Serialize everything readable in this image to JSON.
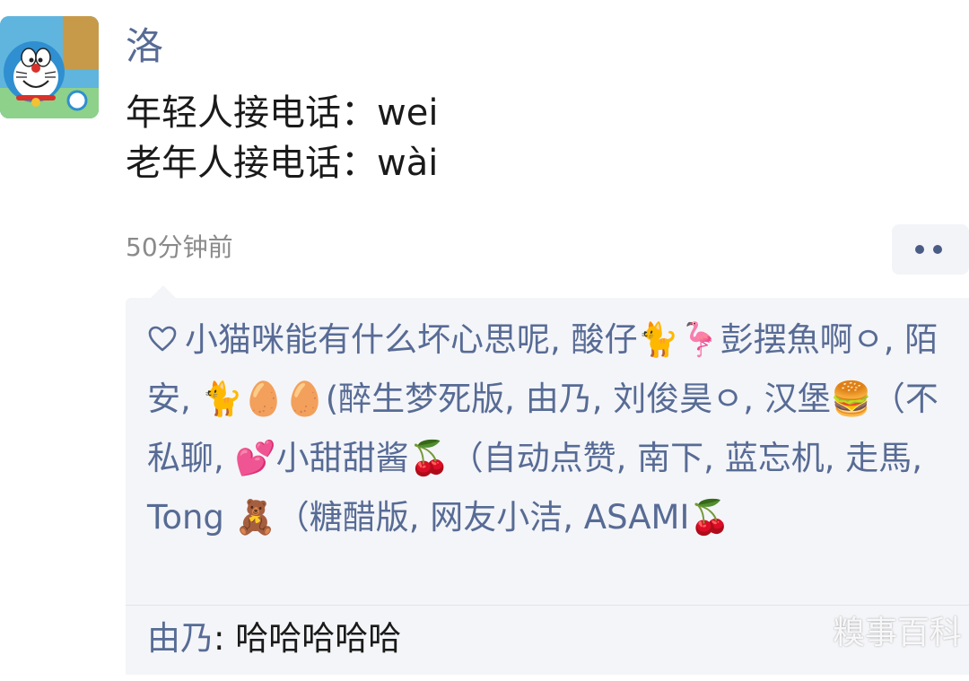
{
  "post": {
    "avatar_icon": "doraemon-avatar-icon",
    "username": "洛",
    "lines": [
      "年轻人接电话：wei",
      "老年人接电话：wài"
    ],
    "time": "50分钟前",
    "more_icon": "more-dots-icon"
  },
  "likes": {
    "icon": "heart-outline-icon",
    "text": "小猫咪能有什么坏心思呢, 酸仔🐈🦩彭摆魚啊ㅇ, 陌安, 🐈🥚🥚(醉生梦死版, 由乃, 刘俊昊ㅇ, 汉堡🍔（不私聊, 💕小甜甜酱🍒（自动点赞, 南下, 蓝忘机, 走馬, Tong 🧸（糖醋版, 网友小洁, ASAMI🍒"
  },
  "comment": {
    "commenter": "由乃",
    "separator": ": ",
    "text": "哈哈哈哈哈"
  },
  "watermark": {
    "text": "糗事百科"
  },
  "colors": {
    "link": "#576b95",
    "panel_bg": "#f4f5f8",
    "time": "#8a8a8a"
  }
}
